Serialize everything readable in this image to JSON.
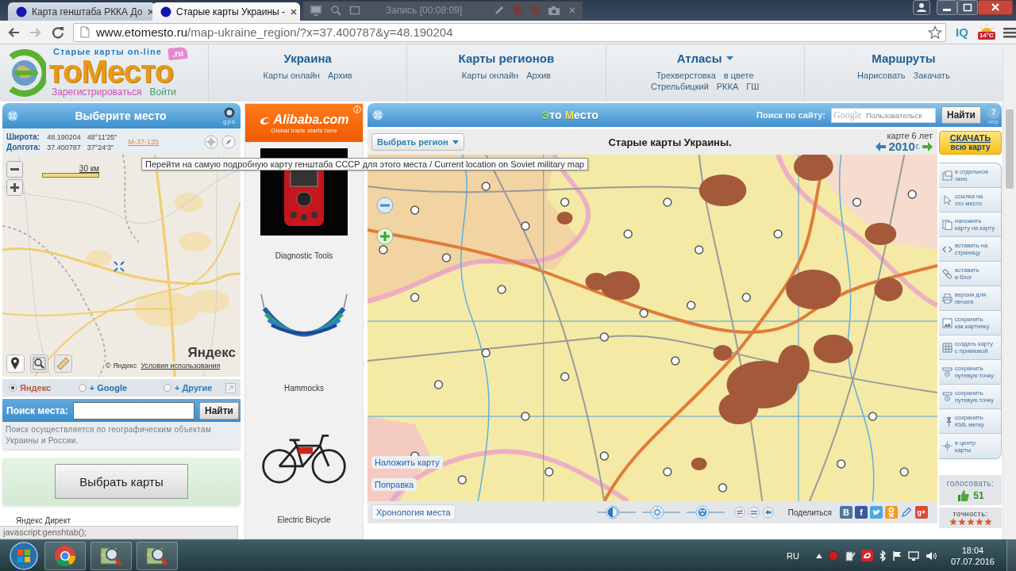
{
  "browser": {
    "tabs": [
      {
        "title": "Карта генштаба РККА До",
        "selected": false
      },
      {
        "title": "Старые карты Украины -",
        "selected": true
      }
    ],
    "recorder": "Запись [00:08:09]",
    "url_host": "www.etomesto.ru",
    "url_path": "/map-ukraine_region/?x=37.400787&y=48.190204",
    "extension": "IQ",
    "temperature": "14°C",
    "status": "javascript:genshtab();"
  },
  "header": {
    "tagline": "Старые карты on-line",
    "logo": "тоМесто",
    "domain": ".ru",
    "register": "Зарегистрироваться",
    "login": "Войти",
    "nav": [
      {
        "title": "Украина",
        "dropdown": false,
        "rows": [
          [
            "Карты онлайн",
            "Архив"
          ]
        ]
      },
      {
        "title": "Карты регионов",
        "dropdown": false,
        "rows": [
          [
            "Карты онлайн",
            "Архив"
          ]
        ]
      },
      {
        "title": "Атласы",
        "dropdown": true,
        "rows": [
          [
            "Трехверстовка",
            "в цвете"
          ],
          [
            "Стрельбицкий",
            "РККА",
            "ГШ"
          ]
        ]
      },
      {
        "title": "Маршруты",
        "dropdown": false,
        "rows": [
          [
            "Нарисовать",
            "Закачать"
          ]
        ]
      }
    ]
  },
  "place_panel": {
    "title": "Выберите место",
    "gps": "gps",
    "coordinates": [
      {
        "label": "Широта:",
        "decimal": "48.190204",
        "dms": "48°11'25\""
      },
      {
        "label": "Долгота:",
        "decimal": "37.400787",
        "dms": "37°24'3\""
      }
    ],
    "sheet": "M-37-135",
    "tooltip": "Перейти на самую подробную карту генштаба СССР для этого места / Current location on Soviet military map",
    "map": {
      "scale": "30 км",
      "logo": "Яндекс",
      "copyright": "© Яндекс",
      "terms": "Условия использования"
    },
    "providers": [
      {
        "label": "Яндекс",
        "selected": true
      },
      {
        "label": "+ Google",
        "selected": false
      },
      {
        "label": "+ Другие",
        "selected": false
      }
    ],
    "search": {
      "label": "Поиск места:",
      "button": "Найти"
    },
    "note": "Поиск осуществляется по географическим объектам Украины и России.",
    "choose_button": "Выбрать карты",
    "ad_label": "Яндекс Директ"
  },
  "ads": {
    "brand": "Alibaba.com",
    "slogan": "Global trade starts here",
    "items": [
      {
        "kind": "scanner",
        "title": "Diagnostic Tools"
      },
      {
        "kind": "hammock",
        "title": "Hammocks"
      },
      {
        "kind": "bicycle",
        "title": "Electric Bicycle"
      }
    ]
  },
  "map_panel": {
    "title": "Это Место",
    "search": {
      "label": "Поиск по сайту:",
      "brand": "Google",
      "placeholder": "Пользовательск",
      "button": "Найти"
    },
    "help": {
      "symbol": "?",
      "label": "help"
    },
    "region_button": "Выбрать регион",
    "heading": "Старые карты Украины.",
    "age": "карте 6 лет",
    "year": "2010",
    "year_unit": "г.",
    "download": [
      "СКАЧАТЬ",
      "всю карту"
    ],
    "overlays": [
      "Наложить карту",
      "Поправка"
    ],
    "history_button": "Хронология места",
    "sliders": [
      {
        "kind": "contrast",
        "level": 0.4
      },
      {
        "kind": "brightness",
        "level": 0.4
      },
      {
        "kind": "color",
        "level": 0.42
      }
    ],
    "share_label": "Поделиться",
    "share": [
      {
        "kind": "vk",
        "label": "В"
      },
      {
        "kind": "facebook",
        "label": "f"
      },
      {
        "kind": "twitter"
      },
      {
        "kind": "ok"
      },
      {
        "kind": "bookmark"
      },
      {
        "kind": "gplus",
        "label": "g+"
      }
    ],
    "tools": [
      {
        "kind": "window",
        "label": "в отдельное\nокно"
      },
      {
        "kind": "pointer",
        "label": "ссылка на\nэто место"
      },
      {
        "kind": "overlay",
        "label": "наложить\nкарту на карту"
      },
      {
        "kind": "embed",
        "label": "вставить на\nстраницу"
      },
      {
        "kind": "blog",
        "label": "вставить\nв блог"
      },
      {
        "kind": "print",
        "label": "версия для\nпечати"
      },
      {
        "kind": "image",
        "label": "сохранить\nкак картинку"
      },
      {
        "kind": "grid",
        "label": "создать карту\nс привязкой"
      },
      {
        "kind": "waypoint",
        "label": "сохранить\nпутевую точку"
      },
      {
        "kind": "waypoint",
        "label": "сохранить\nпутевую точку"
      },
      {
        "kind": "placemark",
        "label": "сохранить\nKML метку"
      },
      {
        "kind": "center",
        "label": "в центр\nкарты"
      }
    ],
    "rating": {
      "vote_label": "голосовать:",
      "votes": "51",
      "accuracy_label": "точность:",
      "stars": 5
    }
  },
  "taskbar": {
    "language": "RU",
    "time": "18:04",
    "date": "07.07.2016"
  }
}
